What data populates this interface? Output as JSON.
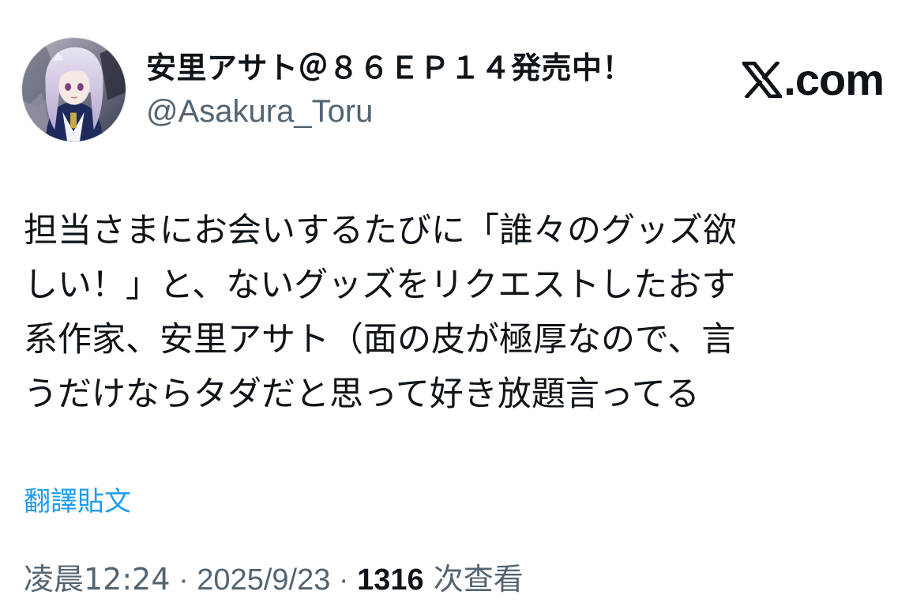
{
  "author": {
    "display_name": "安里アサト＠８６ＥＰ１４発売中！",
    "handle": "@Asakura_Toru",
    "avatar_icon": "avatar-image"
  },
  "brand": {
    "logo_icon": "x-logo-icon",
    "text": ".com"
  },
  "tweet": {
    "lines": [
      "担当さまにお会いするたびに「誰々のグッズ欲",
      "しい！」と、ないグッズをリクエストしたおす",
      "系作家、安里アサト（面の皮が極厚なので、言",
      "うだけならタダだと思って好き放題言ってる"
    ]
  },
  "translate_label": "翻譯貼文",
  "meta": {
    "time": "凌晨12:24",
    "separator": " · ",
    "date": "2025/9/23",
    "views_count": "1316",
    "views_label": " 次查看"
  }
}
